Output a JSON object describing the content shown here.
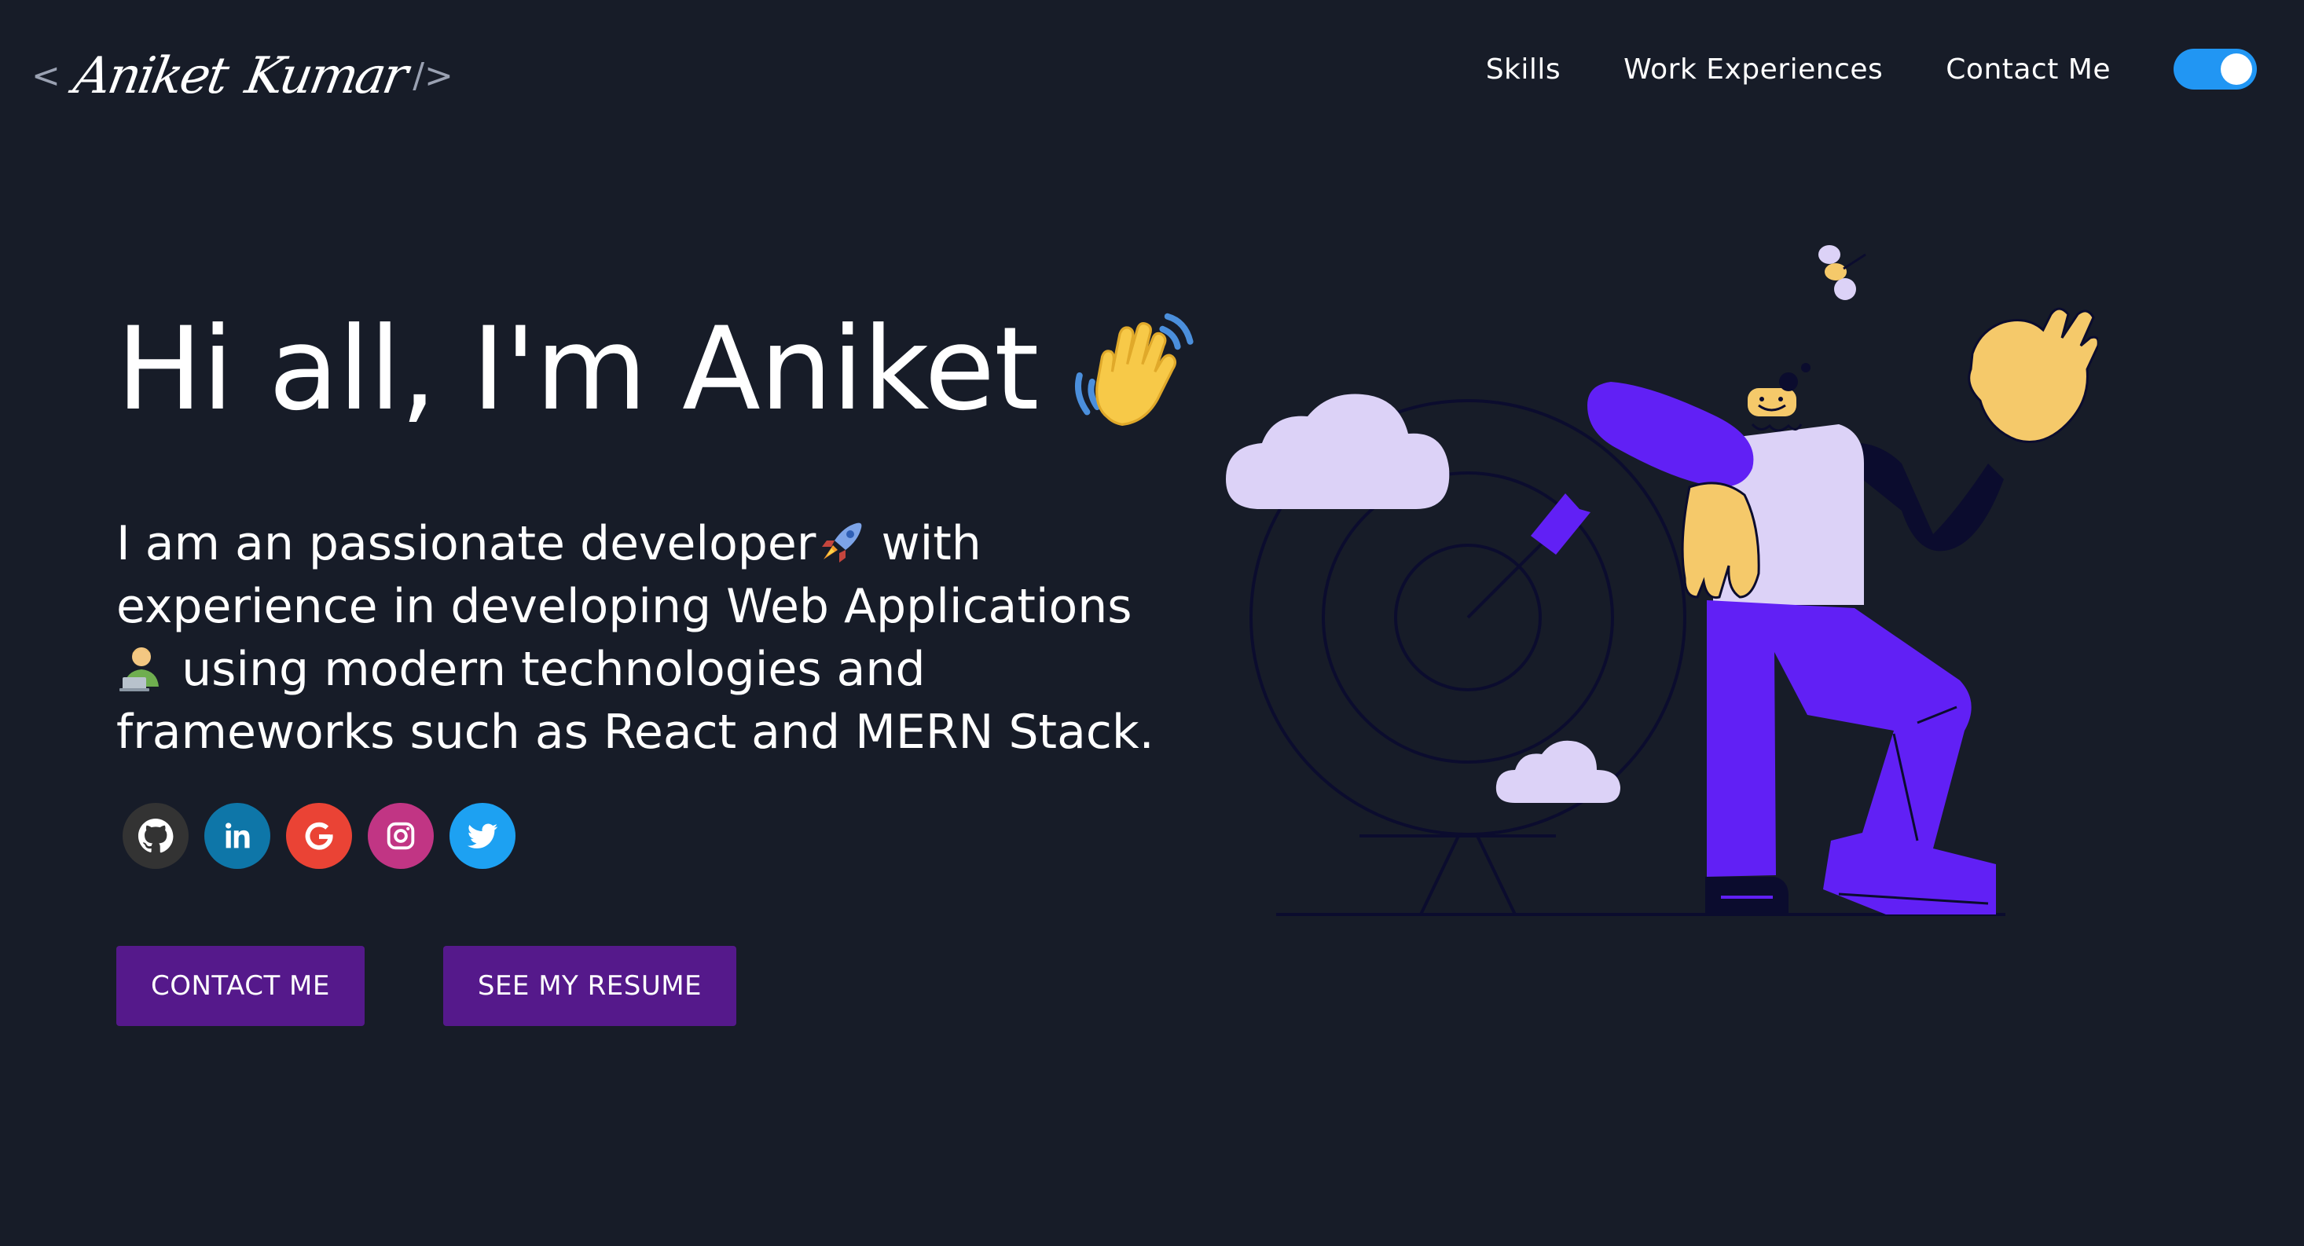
{
  "header": {
    "logo": {
      "open_bracket": "<",
      "first_name": "Aniket",
      "last_name": "Kumar",
      "close_bracket": "/>"
    },
    "nav": [
      {
        "label": "Skills"
      },
      {
        "label": "Work Experiences"
      },
      {
        "label": "Contact Me"
      }
    ],
    "theme_toggle": {
      "on": true,
      "color": "#2196f3"
    }
  },
  "greeting": {
    "title": "Hi all, I'm Aniket",
    "title_icon": "waving-hand-icon",
    "subtitle_part1": "I am an passionate developer",
    "subtitle_icon1": "rocket-icon",
    "subtitle_part2": " with experience in developing Web Applications ",
    "subtitle_icon2": "technologist-icon",
    "subtitle_part3": " using modern technologies and frameworks such as React and MERN Stack."
  },
  "social": [
    {
      "name": "github-icon",
      "color": "#333333"
    },
    {
      "name": "linkedin-icon",
      "color": "#0e76a8"
    },
    {
      "name": "google-icon",
      "color": "#ea4335"
    },
    {
      "name": "instagram-icon",
      "color": "#c13584"
    },
    {
      "name": "twitter-icon",
      "color": "#1da1f2"
    }
  ],
  "buttons": {
    "contact_label": "CONTACT ME",
    "resume_label": "SEE MY RESUME",
    "color": "#55198b"
  },
  "colors": {
    "background": "#171c28",
    "accent_purple": "#6120f5",
    "cloud": "#dcd2f7",
    "skin": "#f5c96a"
  }
}
